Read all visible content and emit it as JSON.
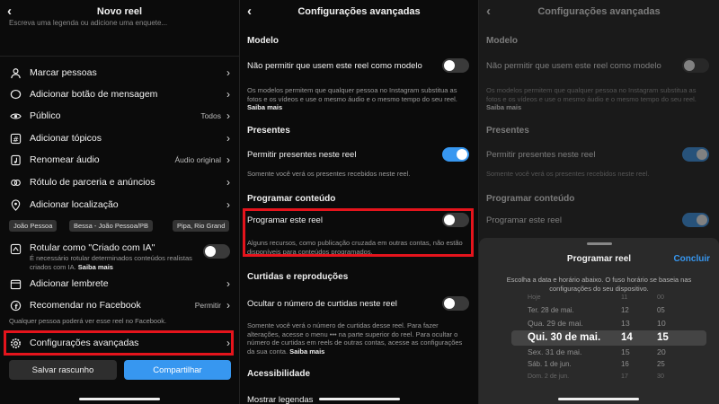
{
  "panel1": {
    "title": "Novo reel",
    "caption_placeholder": "Escreva uma legenda ou adicione uma enquete...",
    "items": [
      {
        "label": "Marcar pessoas"
      },
      {
        "label": "Adicionar botão de mensagem"
      },
      {
        "label": "Público",
        "value": "Todos"
      },
      {
        "label": "Adicionar tópicos"
      },
      {
        "label": "Renomear áudio",
        "value": "Áudio original"
      },
      {
        "label": "Rótulo de parceria e anúncios"
      },
      {
        "label": "Adicionar localização"
      }
    ],
    "locations": [
      "João Pessoa",
      "Bessa - João Pessoa/PB",
      "Pipa, Rio Grand"
    ],
    "ai_label": "Rotular como \"Criado com IA\"",
    "ai_desc": "É necessário rotular determinados conteúdos realistas criados com IA.",
    "ai_link": "Saiba mais",
    "reminder": "Adicionar lembrete",
    "facebook": "Recomendar no Facebook",
    "facebook_value": "Permitir",
    "facebook_desc": "Qualquer pessoa poderá ver esse reel no Facebook.",
    "advanced": "Configurações avançadas",
    "draft_button": "Salvar rascunho",
    "share_button": "Compartilhar"
  },
  "panel2": {
    "title": "Configurações avançadas",
    "sec_model": "Modelo",
    "model_label": "Não permitir que usem este reel como modelo",
    "model_desc": "Os modelos permitem que qualquer pessoa no Instagram substitua as fotos e os vídeos e use o mesmo áudio e o mesmo tempo do seu reel.",
    "link": "Saiba mais",
    "sec_gifts": "Presentes",
    "gifts_label": "Permitir presentes neste reel",
    "gifts_desc": "Somente você verá os presentes recebidos neste reel.",
    "sec_schedule": "Programar conteúdo",
    "schedule_label": "Programar este reel",
    "schedule_desc": "Alguns recursos, como publicação cruzada em outras contas, não estão disponíveis para conteúdos programados.",
    "sec_likes": "Curtidas e reproduções",
    "likes_label": "Ocultar o número de curtidas neste reel",
    "likes_desc": "Somente você verá o número de curtidas desse reel. Para fazer alterações, acesse o menu ••• na parte superior do reel. Para ocultar o número de curtidas em reels de outras contas, acesse as configurações da sua conta.",
    "sec_access": "Acessibilidade",
    "captions_label": "Mostrar legendas"
  },
  "panel3": {
    "sheet_title": "Programar reel",
    "done": "Concluir",
    "sheet_desc": "Escolha a data e horário abaixo. O fuso horário se baseia nas configurações do seu dispositivo.",
    "picker": [
      {
        "date": "Hoje",
        "hour": "11",
        "min": "00"
      },
      {
        "date": "Ter. 28 de mai.",
        "hour": "12",
        "min": "05"
      },
      {
        "date": "Qua. 29 de mai.",
        "hour": "13",
        "min": "10"
      },
      {
        "date": "Qui. 30 de mai.",
        "hour": "14",
        "min": "15"
      },
      {
        "date": "Sex. 31 de mai.",
        "hour": "15",
        "min": "20"
      },
      {
        "date": "Sáb. 1 de jun.",
        "hour": "16",
        "min": "25"
      },
      {
        "date": "Dom. 2 de jun.",
        "hour": "17",
        "min": "30"
      }
    ]
  },
  "colors": {
    "accent": "#3797f0",
    "highlight": "#e5141c",
    "bg": "#0b0b0b"
  }
}
